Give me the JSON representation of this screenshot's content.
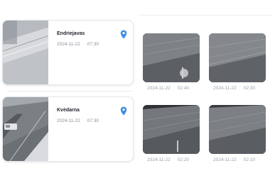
{
  "cameras": [
    {
      "name": "Endriejavas",
      "date": "2024-11-22",
      "time": "07:30",
      "icon": "location-pin-icon",
      "thumbnail": "snowy-road-daytime"
    },
    {
      "name": "Kvėdarna",
      "date": "2024-11-22",
      "time": "07:30",
      "icon": "location-pin-icon",
      "thumbnail": "road-with-car-daytime"
    }
  ],
  "history": [
    {
      "date": "2024-11-22",
      "time": "02:40",
      "thumbnail": "night-road-grayscale"
    },
    {
      "date": "2024-11-22",
      "time": "02:30",
      "thumbnail": "night-road-grayscale"
    },
    {
      "date": "2024-11-22",
      "time": "02:20",
      "thumbnail": "night-road-grayscale"
    },
    {
      "date": "2024-11-22",
      "time": "02:10",
      "thumbnail": "night-road-grayscale"
    }
  ],
  "colors": {
    "pin": "#3d8fe0",
    "card_border": "#e3e6ea",
    "meta_text": "#8a9099"
  }
}
